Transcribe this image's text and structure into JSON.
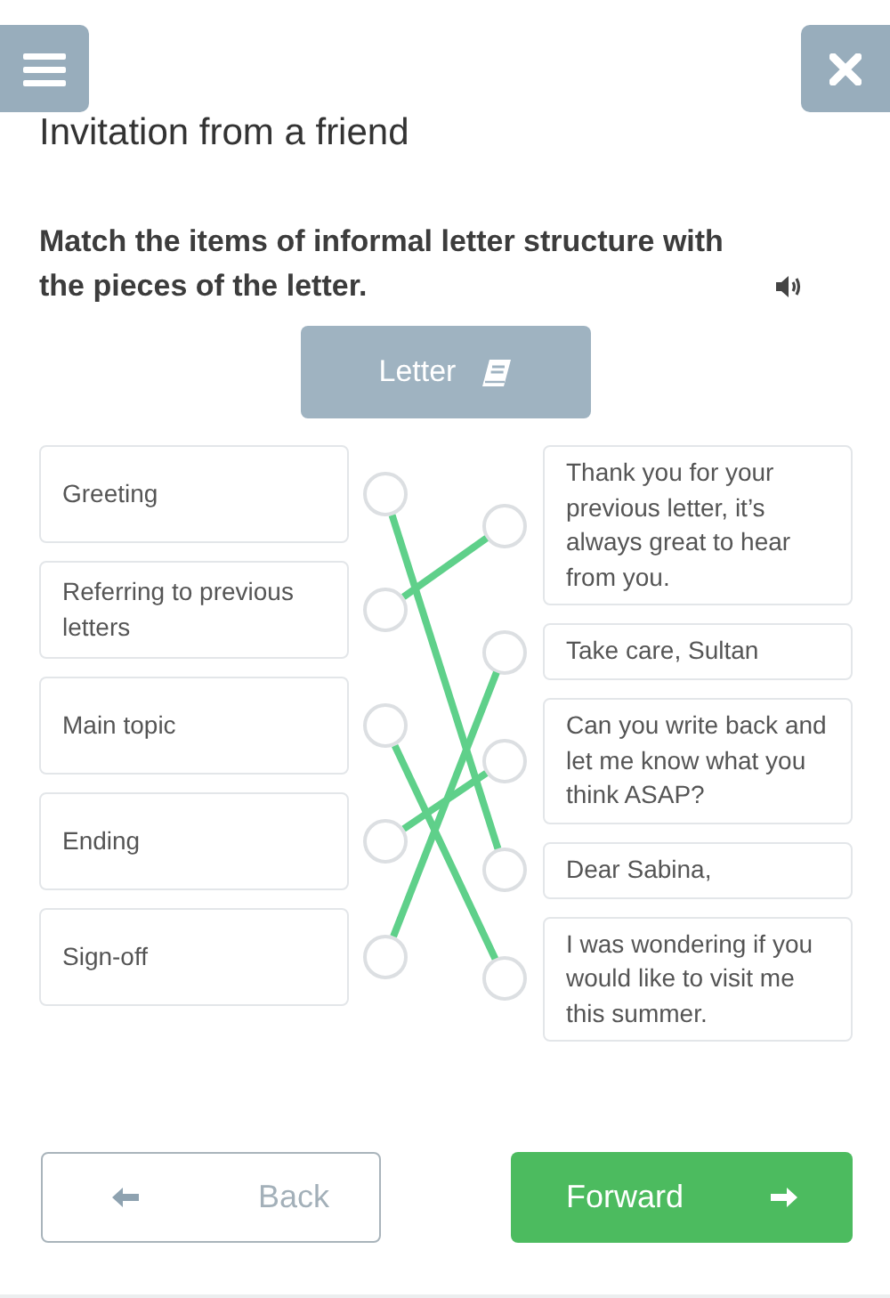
{
  "header": {
    "title": "Invitation from a friend"
  },
  "instruction": "Match the items of informal letter structure with the pieces of the letter.",
  "letter_button": {
    "label": "Letter"
  },
  "left_items": [
    {
      "text": "Greeting",
      "linked": [
        false,
        false,
        false,
        true,
        false
      ]
    },
    {
      "text": "Referring to previous letters",
      "linked": [
        true,
        false,
        false,
        false,
        false
      ]
    },
    {
      "text": "Main topic",
      "linked": [
        false,
        false,
        false,
        false,
        true
      ]
    },
    {
      "text": "Ending",
      "linked": [
        false,
        false,
        true,
        false,
        false
      ]
    },
    {
      "text": "Sign-off",
      "linked": [
        false,
        true,
        false,
        false,
        false
      ]
    }
  ],
  "right_items": [
    {
      "text": "Thank you for your previous letter, it’s always great to hear from you."
    },
    {
      "text": "Take care, Sultan"
    },
    {
      "text": "Can you write back and let me know what you think ASAP?"
    },
    {
      "text": "Dear Sabina,"
    },
    {
      "text": "I was wondering if you would like to visit me this summer."
    }
  ],
  "navigation": {
    "back": "Back",
    "forward": "Forward"
  }
}
